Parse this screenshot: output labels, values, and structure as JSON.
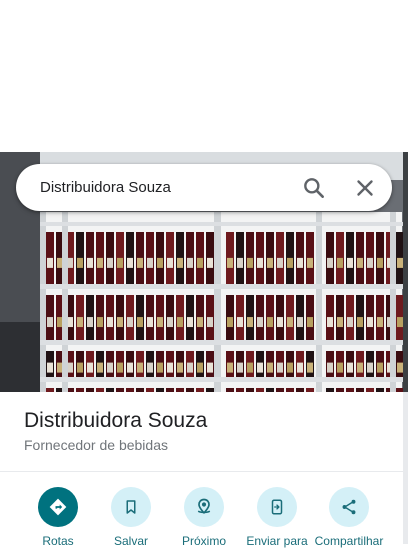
{
  "search": {
    "value": "Distribuidora Souza"
  },
  "place": {
    "title": "Distribuidora Souza",
    "category": "Fornecedor de bebidas"
  },
  "actions": [
    {
      "label": "Rotas",
      "icon": "directions-icon"
    },
    {
      "label": "Salvar",
      "icon": "bookmark-icon"
    },
    {
      "label": "Próximo",
      "icon": "nearby-icon"
    },
    {
      "label": "Enviar para",
      "icon": "send-to-phone-icon"
    },
    {
      "label": "Compartilhar",
      "icon": "share-icon"
    }
  ],
  "colors": {
    "accent": "#00727f",
    "action_bg": "#d4f0f7",
    "action_text": "#1a6d79"
  }
}
